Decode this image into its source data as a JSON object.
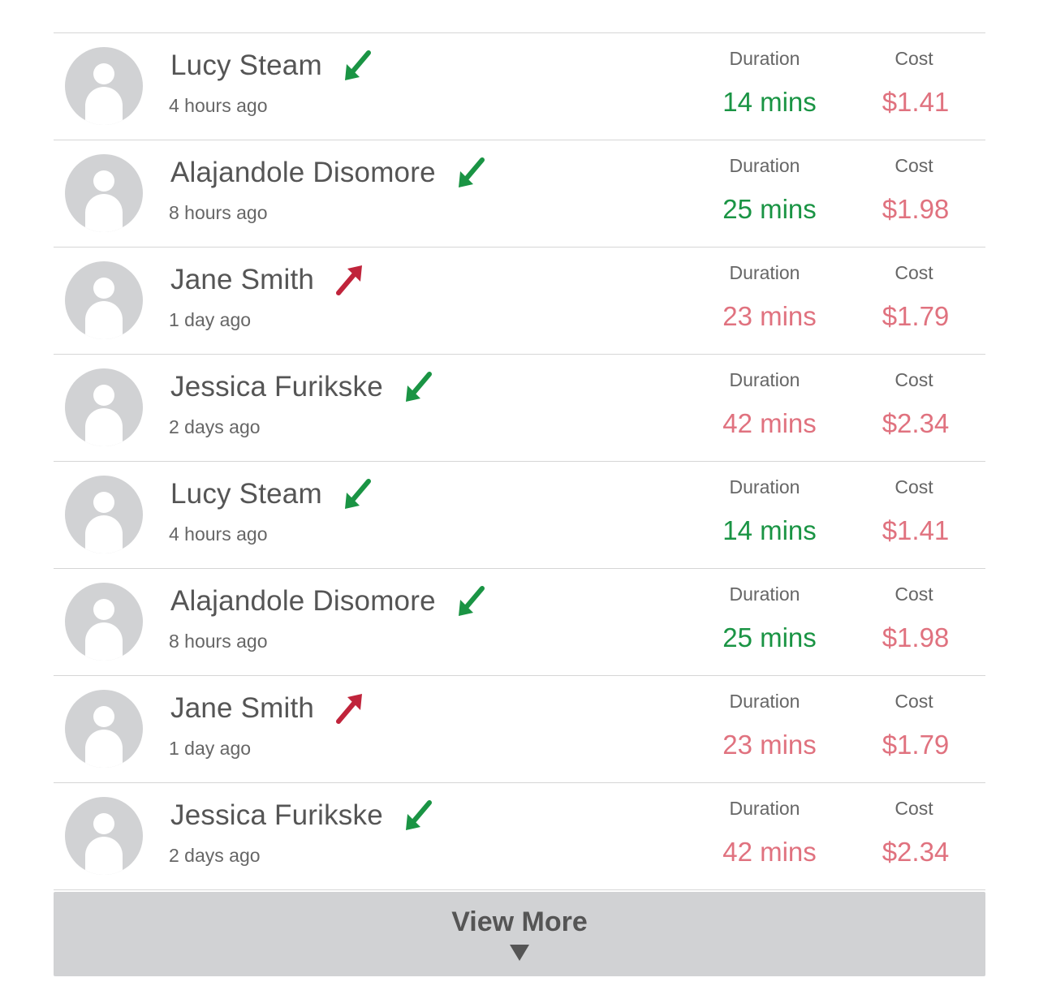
{
  "colors": {
    "green": "#1a9444",
    "pink": "#e0727f",
    "red_arrow": "#c0243b",
    "avatar": "#d1d2d4"
  },
  "calls": [
    {
      "name": "Lucy Steam",
      "time": "4 hours ago",
      "direction": "incoming",
      "duration_label": "Duration",
      "duration": "14 mins",
      "duration_color": "green",
      "cost_label": "Cost",
      "cost": "$1.41"
    },
    {
      "name": "Alajandole Disomore",
      "time": "8 hours ago",
      "direction": "incoming",
      "duration_label": "Duration",
      "duration": "25 mins",
      "duration_color": "green",
      "cost_label": "Cost",
      "cost": "$1.98"
    },
    {
      "name": "Jane Smith",
      "time": "1 day ago",
      "direction": "outgoing",
      "duration_label": "Duration",
      "duration": "23 mins",
      "duration_color": "pink",
      "cost_label": "Cost",
      "cost": "$1.79"
    },
    {
      "name": "Jessica Furikske",
      "time": "2 days ago",
      "direction": "incoming",
      "duration_label": "Duration",
      "duration": "42 mins",
      "duration_color": "pink",
      "cost_label": "Cost",
      "cost": "$2.34"
    },
    {
      "name": "Lucy Steam",
      "time": "4 hours ago",
      "direction": "incoming",
      "duration_label": "Duration",
      "duration": "14 mins",
      "duration_color": "green",
      "cost_label": "Cost",
      "cost": "$1.41"
    },
    {
      "name": "Alajandole Disomore",
      "time": "8 hours ago",
      "direction": "incoming",
      "duration_label": "Duration",
      "duration": "25 mins",
      "duration_color": "green",
      "cost_label": "Cost",
      "cost": "$1.98"
    },
    {
      "name": "Jane Smith",
      "time": "1 day ago",
      "direction": "outgoing",
      "duration_label": "Duration",
      "duration": "23 mins",
      "duration_color": "pink",
      "cost_label": "Cost",
      "cost": "$1.79"
    },
    {
      "name": "Jessica Furikske",
      "time": "2 days ago",
      "direction": "incoming",
      "duration_label": "Duration",
      "duration": "42 mins",
      "duration_color": "pink",
      "cost_label": "Cost",
      "cost": "$2.34"
    }
  ],
  "view_more": {
    "label": "View More",
    "icon": "caret-down-icon"
  }
}
